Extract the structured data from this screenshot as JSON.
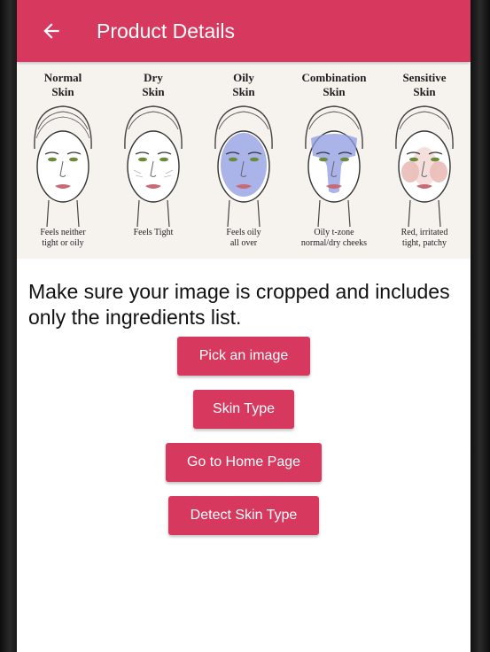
{
  "app_bar": {
    "title": "Product Details",
    "back_icon": "arrow-back-icon",
    "color": "#d7385e"
  },
  "skin_types": [
    {
      "name_line1": "Normal",
      "name_line2": "Skin",
      "desc_line1": "Feels neither",
      "desc_line2": "tight or oily",
      "tint": "none"
    },
    {
      "name_line1": "Dry",
      "name_line2": "Skin",
      "desc_line1": "Feels Tight",
      "desc_line2": "",
      "tint": "dry-lines"
    },
    {
      "name_line1": "Oily",
      "name_line2": "Skin",
      "desc_line1": "Feels oily",
      "desc_line2": "all over",
      "tint": "#8e9be0"
    },
    {
      "name_line1": "Combination",
      "name_line2": "Skin",
      "desc_line1": "Oily t-zone",
      "desc_line2": "normal/dry cheeks",
      "tint": "#8e9be0"
    },
    {
      "name_line1": "Sensitive",
      "name_line2": "Skin",
      "desc_line1": "Red, irritated",
      "desc_line2": "tight, patchy",
      "tint": "#e4a8a4"
    }
  ],
  "instruction": "Make sure your image is cropped and includes only the ingredients list.",
  "buttons": {
    "pick_image": "Pick an image",
    "skin_type": "Skin Type",
    "home_page": "Go to Home Page",
    "detect_skin": "Detect Skin Type"
  }
}
